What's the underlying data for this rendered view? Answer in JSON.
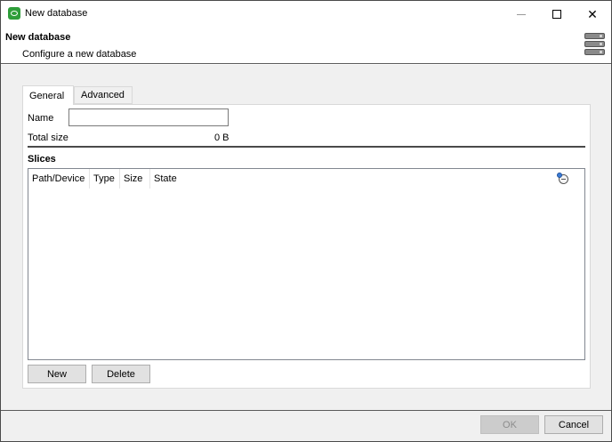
{
  "window": {
    "title": "New database",
    "controls": {
      "minimize": "—",
      "maximize": "□",
      "close": "✕"
    }
  },
  "header": {
    "title": "New database",
    "subtitle": "Configure a new database",
    "icon": "database-icon"
  },
  "tabs": [
    {
      "label": "General",
      "active": true
    },
    {
      "label": "Advanced",
      "active": false
    }
  ],
  "general": {
    "name_label": "Name",
    "name_value": "",
    "total_size_label": "Total size",
    "total_size_value": "0 B",
    "slices_label": "Slices",
    "slices_columns": [
      "Path/Device",
      "Type",
      "Size",
      "State"
    ],
    "slices_rows": [],
    "new_button": "New",
    "delete_button": "Delete"
  },
  "footer": {
    "ok_label": "OK",
    "ok_enabled": false,
    "cancel_label": "Cancel"
  },
  "colors": {
    "app_icon": "#2e9e3a",
    "panel_bg": "#f0f0f0",
    "button_bg": "#e1e1e1"
  }
}
